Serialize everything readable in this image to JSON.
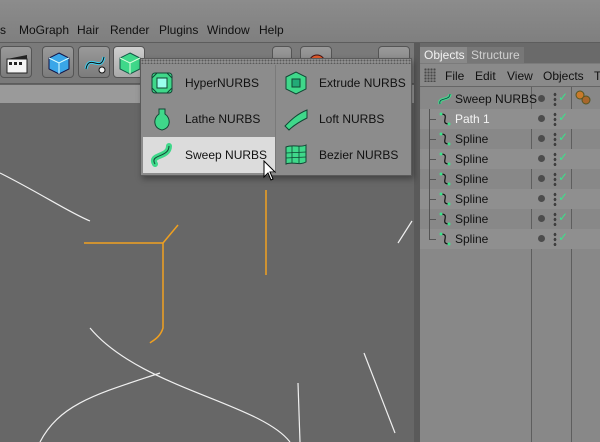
{
  "menubar": {
    "items": [
      "s",
      "MoGraph",
      "Hair",
      "Render",
      "Plugins",
      "Window",
      "Help"
    ]
  },
  "toolbar": {
    "buttons": [
      "clapper-icon",
      "cube-icon",
      "spline-pen-icon",
      "nurbs-icon",
      "deformer-icon",
      "light-icon",
      "camera-icon"
    ]
  },
  "nurbs_menu": {
    "items": [
      {
        "label": "HyperNURBS",
        "icon": "hypernurbs-icon"
      },
      {
        "label": "Extrude NURBS",
        "icon": "extrude-nurbs-icon"
      },
      {
        "label": "Lathe NURBS",
        "icon": "lathe-nurbs-icon"
      },
      {
        "label": "Loft NURBS",
        "icon": "loft-nurbs-icon"
      },
      {
        "label": "Sweep NURBS",
        "icon": "sweep-nurbs-icon",
        "highlighted": true
      },
      {
        "label": "Bezier NURBS",
        "icon": "bezier-nurbs-icon"
      }
    ]
  },
  "panel": {
    "tabs": [
      "Objects",
      "Structure"
    ],
    "menu": [
      "File",
      "Edit",
      "View",
      "Objects",
      "T"
    ]
  },
  "objects": [
    {
      "name": "Sweep NURBS",
      "icon": "sweep-nurbs-icon",
      "selected": false
    },
    {
      "name": "Path 1",
      "icon": "spline-icon",
      "selected": true
    },
    {
      "name": "Spline",
      "icon": "spline-icon",
      "selected": false
    },
    {
      "name": "Spline",
      "icon": "spline-icon",
      "selected": false
    },
    {
      "name": "Spline",
      "icon": "spline-icon",
      "selected": false
    },
    {
      "name": "Spline",
      "icon": "spline-icon",
      "selected": false
    },
    {
      "name": "Spline",
      "icon": "spline-icon",
      "selected": false
    },
    {
      "name": "Spline",
      "icon": "spline-icon",
      "selected": false
    }
  ],
  "colors": {
    "accent_green": "#3fe08a",
    "spline_orange": "#f0a020",
    "spline_white": "#f0f0f0"
  }
}
